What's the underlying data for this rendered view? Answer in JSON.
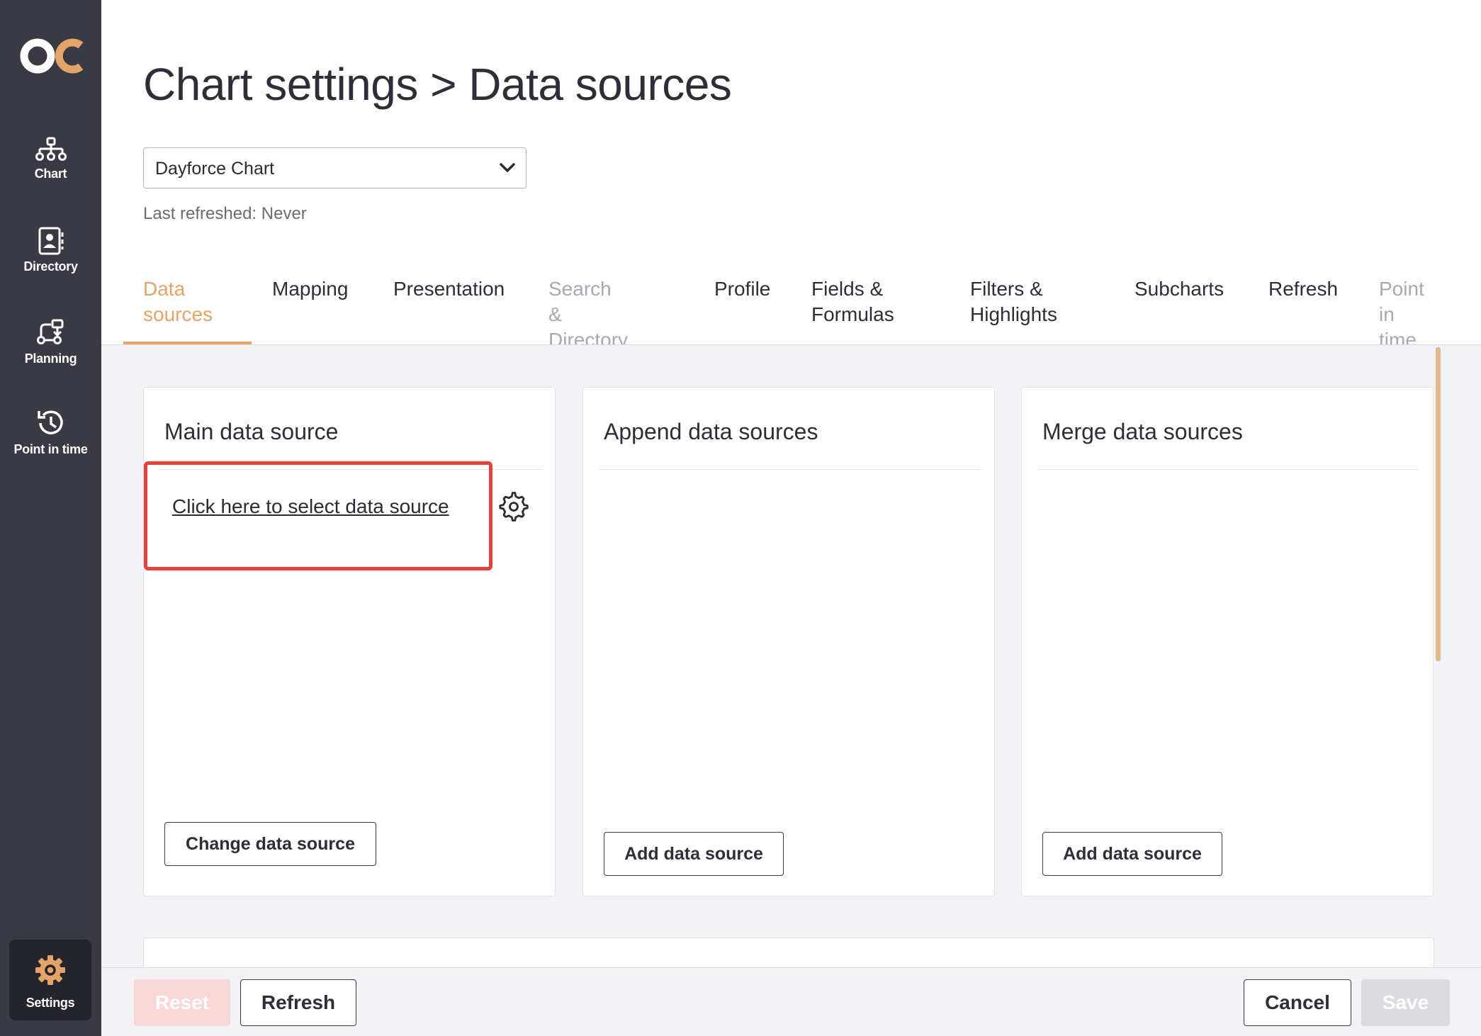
{
  "sidebar": {
    "items": [
      {
        "label": "Chart",
        "icon": "org-chart-icon"
      },
      {
        "label": "Directory",
        "icon": "directory-icon"
      },
      {
        "label": "Planning",
        "icon": "planning-icon"
      },
      {
        "label": "Point in time",
        "icon": "history-icon"
      }
    ],
    "settings": {
      "label": "Settings",
      "icon": "gear-icon"
    },
    "accent_color": "#e3a468"
  },
  "header": {
    "title": "Chart settings > Data sources",
    "chart_select": {
      "value": "Dayforce Chart"
    },
    "last_refreshed": "Last refreshed: Never"
  },
  "tabs": [
    {
      "line1": "Data",
      "line2": "sources",
      "state": "active"
    },
    {
      "line1": "Mapping",
      "line2": "",
      "state": "normal"
    },
    {
      "line1": "Presentation",
      "line2": "",
      "state": "normal"
    },
    {
      "line1": "Search &",
      "line2": "Directory",
      "state": "disabled"
    },
    {
      "line1": "Profile",
      "line2": "",
      "state": "normal"
    },
    {
      "line1": "Fields &",
      "line2": "Formulas",
      "state": "normal"
    },
    {
      "line1": "Filters &",
      "line2": "Highlights",
      "state": "normal"
    },
    {
      "line1": "Subcharts",
      "line2": "",
      "state": "normal"
    },
    {
      "line1": "Refresh",
      "line2": "",
      "state": "normal"
    },
    {
      "line1": "Point in",
      "line2": "time",
      "state": "disabled"
    }
  ],
  "cards": {
    "main": {
      "title": "Main data source",
      "select_link": "Click here to select data source",
      "button": "Change data source"
    },
    "append": {
      "title": "Append data sources",
      "button": "Add data source"
    },
    "merge": {
      "title": "Merge data sources",
      "button": "Add data source"
    }
  },
  "footer": {
    "reset": "Reset",
    "refresh": "Refresh",
    "cancel": "Cancel",
    "save": "Save"
  }
}
